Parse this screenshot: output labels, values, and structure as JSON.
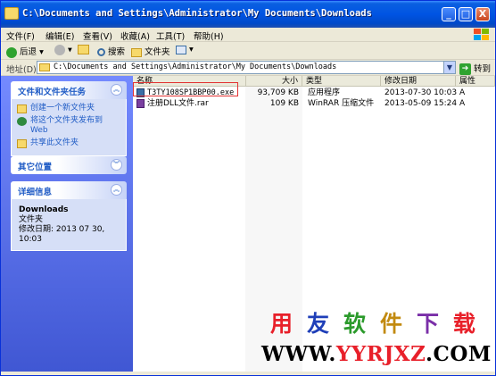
{
  "window": {
    "title": "C:\\Documents and Settings\\Administrator\\My Documents\\Downloads",
    "controls": [
      "_",
      "□",
      "X"
    ]
  },
  "menu": [
    "文件(F)",
    "编辑(E)",
    "查看(V)",
    "收藏(A)",
    "工具(T)",
    "帮助(H)"
  ],
  "toolbar": {
    "back_label": "后退",
    "search_label": "搜索",
    "folders_label": "文件夹"
  },
  "address": {
    "label": "地址(D)",
    "path": "C:\\Documents and Settings\\Administrator\\My Documents\\Downloads",
    "go_label": "转到"
  },
  "sidebar": {
    "tasks_panel": {
      "title": "文件和文件夹任务",
      "items": [
        {
          "label": "创建一个新文件夹",
          "icon": "new-folder-icon"
        },
        {
          "label": "将这个文件夹发布到 Web",
          "icon": "publish-web-icon"
        },
        {
          "label": "共享此文件夹",
          "icon": "share-folder-icon"
        }
      ]
    },
    "other_places": {
      "title": "其它位置"
    },
    "details": {
      "title": "详细信息",
      "name": "Downloads",
      "type": "文件夹",
      "modified": "修改日期: 2013 07 30, 10:03"
    }
  },
  "columns": [
    "名称",
    "大小",
    "类型",
    "修改日期",
    "属性"
  ],
  "files": [
    {
      "name": "T3TY108SP1BBP00.exe",
      "size": "93,709 KB",
      "type": "应用程序",
      "date": "2013-07-30 10:03",
      "attr": "A"
    },
    {
      "name": "注册DLL文件.rar",
      "size": "109 KB",
      "type": "WinRAR 压缩文件",
      "date": "2013-05-09 15:24",
      "attr": "A"
    }
  ],
  "watermark": {
    "chars": [
      "用",
      "友",
      "软",
      "件",
      "下",
      "载"
    ],
    "char_colors": [
      "#e8202a",
      "#1f3fb8",
      "#2b9a2b",
      "#c28a10",
      "#7a2fa8",
      "#e8202a"
    ],
    "url_parts": [
      "WWW.",
      "YYRJXZ",
      ".COM"
    ]
  },
  "colors": {
    "title_bar": "#0054e3",
    "sidebar": "#6375d6",
    "highlight_border": "#e23232",
    "watermark_accent": "#e8202a"
  }
}
